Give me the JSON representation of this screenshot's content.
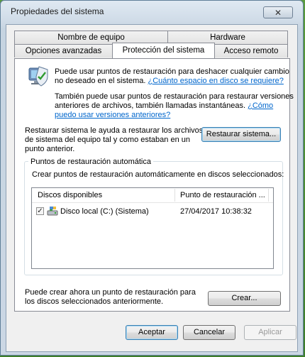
{
  "window": {
    "title": "Propiedades del sistema",
    "close_label": "✕"
  },
  "tabs": {
    "row1": [
      {
        "label": "Nombre de equipo"
      },
      {
        "label": "Hardware"
      }
    ],
    "row2": [
      {
        "label": "Opciones avanzadas"
      },
      {
        "label": "Protección del sistema",
        "active": true
      },
      {
        "label": "Acceso remoto"
      }
    ]
  },
  "panel": {
    "info1_line1": "Puede usar puntos de restauración para deshacer cualquier cambio",
    "info1_line2_prefix": "no deseado en el sistema.",
    "info1_link": "¿Cuánto espacio en disco se requiere?",
    "info2_line1": "También puede usar puntos de restauración para restaurar versiones",
    "info2_line2_prefix": "anteriores de archivos, también llamadas instantáneas.",
    "info2_link_part1": "¿Cómo",
    "info2_link_part2": "puedo usar versiones anteriores?",
    "restore_line1": "Restaurar sistema le ayuda a restaurar los archivos",
    "restore_line2": "de sistema del equipo tal y como estaban en un",
    "restore_line3": "punto anterior.",
    "restore_button": "Restaurar sistema...",
    "group_label": "Puntos de restauración automática",
    "group_description": "Crear puntos de restauración automáticamente en discos seleccionados:",
    "list": {
      "columns": [
        "Discos disponibles",
        "Punto de restauración ..."
      ],
      "rows": [
        {
          "checked": true,
          "disk": "Disco local (C:) (Sistema)",
          "restore_point": "27/04/2017 10:38:32"
        }
      ]
    },
    "create_line1": "Puede crear ahora un punto de restauración para",
    "create_line2": "los discos seleccionados anteriormente.",
    "create_button": "Crear..."
  },
  "footer": {
    "accept": "Aceptar",
    "cancel": "Cancelar",
    "apply": "Aplicar"
  },
  "colors": {
    "link": "#0066cc",
    "window_frame": "#cbd7e4",
    "desktop": "#4a8a33"
  }
}
